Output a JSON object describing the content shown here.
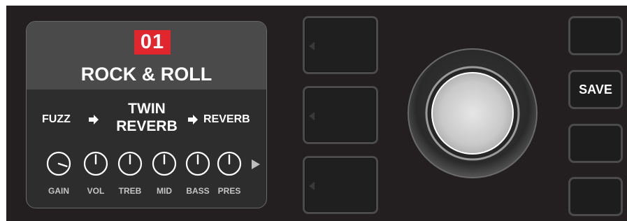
{
  "lcd": {
    "preset_number": "01",
    "preset_name": "ROCK & ROLL",
    "signal_chain": {
      "effect_1": "FUZZ",
      "amp_line1": "TWIN",
      "amp_line2": "REVERB",
      "effect_2": "REVERB"
    },
    "knobs": [
      {
        "label": "GAIN",
        "level": 0.9
      },
      {
        "label": "VOL",
        "level": 0.5
      },
      {
        "label": "TREB",
        "level": 0.5
      },
      {
        "label": "MID",
        "level": 0.5
      },
      {
        "label": "BASS",
        "level": 0.5
      },
      {
        "label": "PRES",
        "level": 0.5
      }
    ]
  },
  "right_buttons": {
    "save_label": "SAVE"
  },
  "colors": {
    "panel": "#231f20",
    "preset_badge": "#e1262d",
    "lcd_header": "#4a4a4a",
    "lcd_body": "#2d2d2d"
  }
}
